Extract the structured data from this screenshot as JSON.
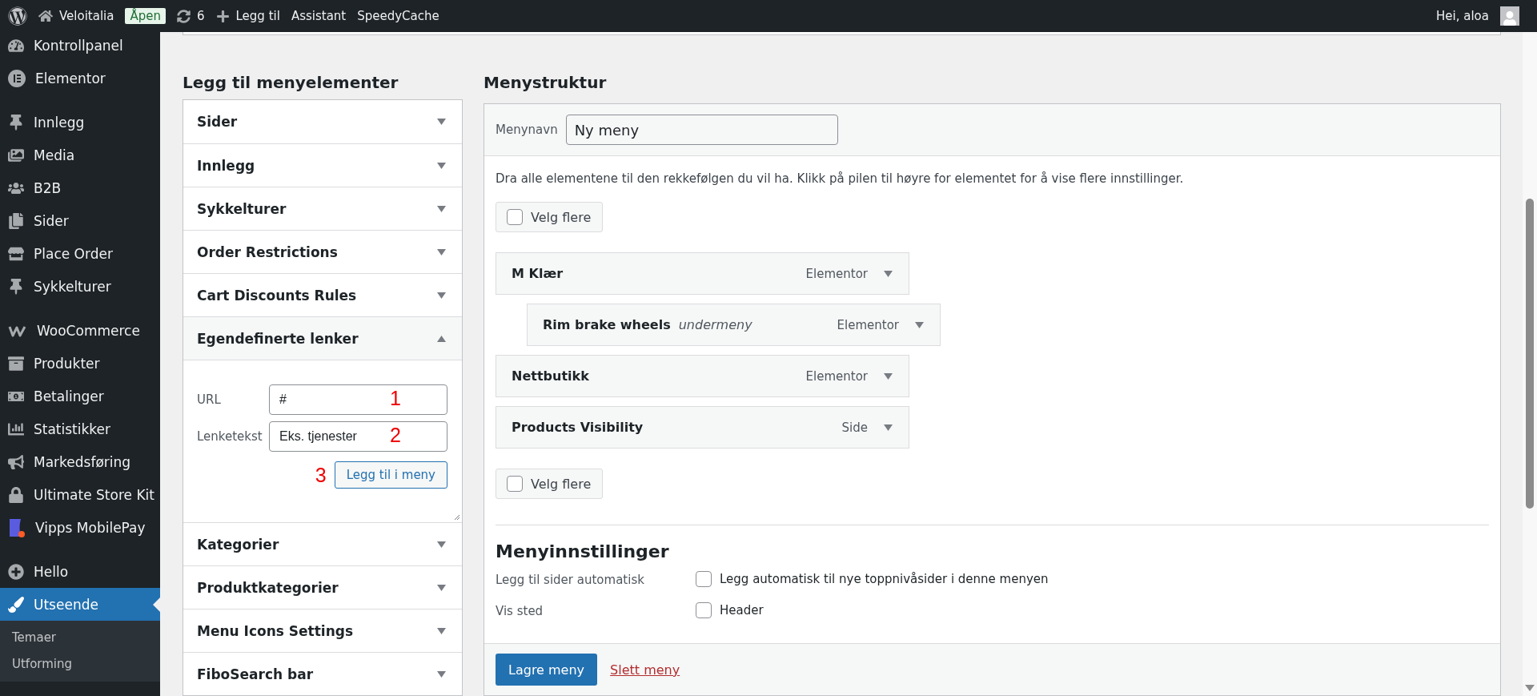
{
  "admin_bar": {
    "site": "Veloitalia",
    "status_badge": "Åpen",
    "updates_count": "6",
    "new_label": "Legg til",
    "items": [
      "Assistant",
      "SpeedyCache"
    ],
    "greeting": "Hei, aloa"
  },
  "sidebar": {
    "groups": [
      [
        {
          "label": "Kontrollpanel",
          "selected": false
        },
        {
          "label": "Elementor",
          "selected": false
        }
      ],
      [
        {
          "label": "Innlegg",
          "selected": false
        },
        {
          "label": "Media",
          "selected": false
        },
        {
          "label": "B2B",
          "selected": false
        },
        {
          "label": "Sider",
          "selected": false
        },
        {
          "label": "Place Order",
          "selected": false
        },
        {
          "label": "Sykkelturer",
          "selected": false
        }
      ],
      [
        {
          "label": "WooCommerce",
          "selected": false
        },
        {
          "label": "Produkter",
          "selected": false
        },
        {
          "label": "Betalinger",
          "selected": false
        },
        {
          "label": "Statistikker",
          "selected": false
        },
        {
          "label": "Markedsføring",
          "selected": false
        },
        {
          "label": "Ultimate Store Kit",
          "selected": false
        },
        {
          "label": "Vipps MobilePay",
          "selected": false
        }
      ],
      [
        {
          "label": "Hello",
          "selected": false
        },
        {
          "label": "Utseende",
          "selected": true
        }
      ]
    ],
    "submenu": [
      "Temaer",
      "Utforming"
    ]
  },
  "add_items": {
    "heading": "Legg til menyelementer",
    "sections": [
      {
        "title": "Sider",
        "expanded": false
      },
      {
        "title": "Innlegg",
        "expanded": false
      },
      {
        "title": "Sykkelturer",
        "expanded": false
      },
      {
        "title": "Order Restrictions",
        "expanded": false
      },
      {
        "title": "Cart Discounts Rules",
        "expanded": false
      },
      {
        "title": "Egendefinerte lenker",
        "expanded": true,
        "fields": [
          {
            "label": "URL",
            "value": "#",
            "annotation": "1"
          },
          {
            "label": "Lenketekst",
            "value": "Eks. tjenester",
            "annotation": "2"
          }
        ],
        "button": {
          "label": "Legg til i meny",
          "annotation": "3"
        }
      },
      {
        "title": "Kategorier",
        "expanded": false
      },
      {
        "title": "Produktkategorier",
        "expanded": false
      },
      {
        "title": "Menu Icons Settings",
        "expanded": false
      },
      {
        "title": "FiboSearch bar",
        "expanded": false
      }
    ]
  },
  "menu_structure": {
    "heading": "Menystruktur",
    "menu_name": {
      "label": "Menynavn",
      "value": "Ny meny"
    },
    "instructions": "Dra alle elementene til den rekkefølgen du vil ha. Klikk på pilen til høyre for elementet for å vise flere innstillinger.",
    "select_top": {
      "label": "Velg flere",
      "checked": false
    },
    "items": [
      {
        "title": "M Klær",
        "type": "Elementor",
        "children": [
          {
            "title": "Rim brake wheels",
            "note": "undermeny",
            "type": "Elementor"
          }
        ]
      },
      {
        "title": "Nettbutikk",
        "type": "Elementor"
      },
      {
        "title": "Products Visibility",
        "type": "Side"
      }
    ],
    "select_bottom": {
      "label": "Velg flere",
      "checked": false
    },
    "settings": {
      "heading": "Menyinnstillinger",
      "rows": [
        {
          "label": "Legg til sider automatisk",
          "options": [
            {
              "label": "Legg automatisk til nye toppnivåsider i denne menyen",
              "checked": false
            }
          ]
        },
        {
          "label": "Vis sted",
          "options": [
            {
              "label": "Header",
              "checked": false
            }
          ]
        }
      ]
    },
    "save_button": "Lagre meny",
    "delete_link": "Slett meny"
  }
}
